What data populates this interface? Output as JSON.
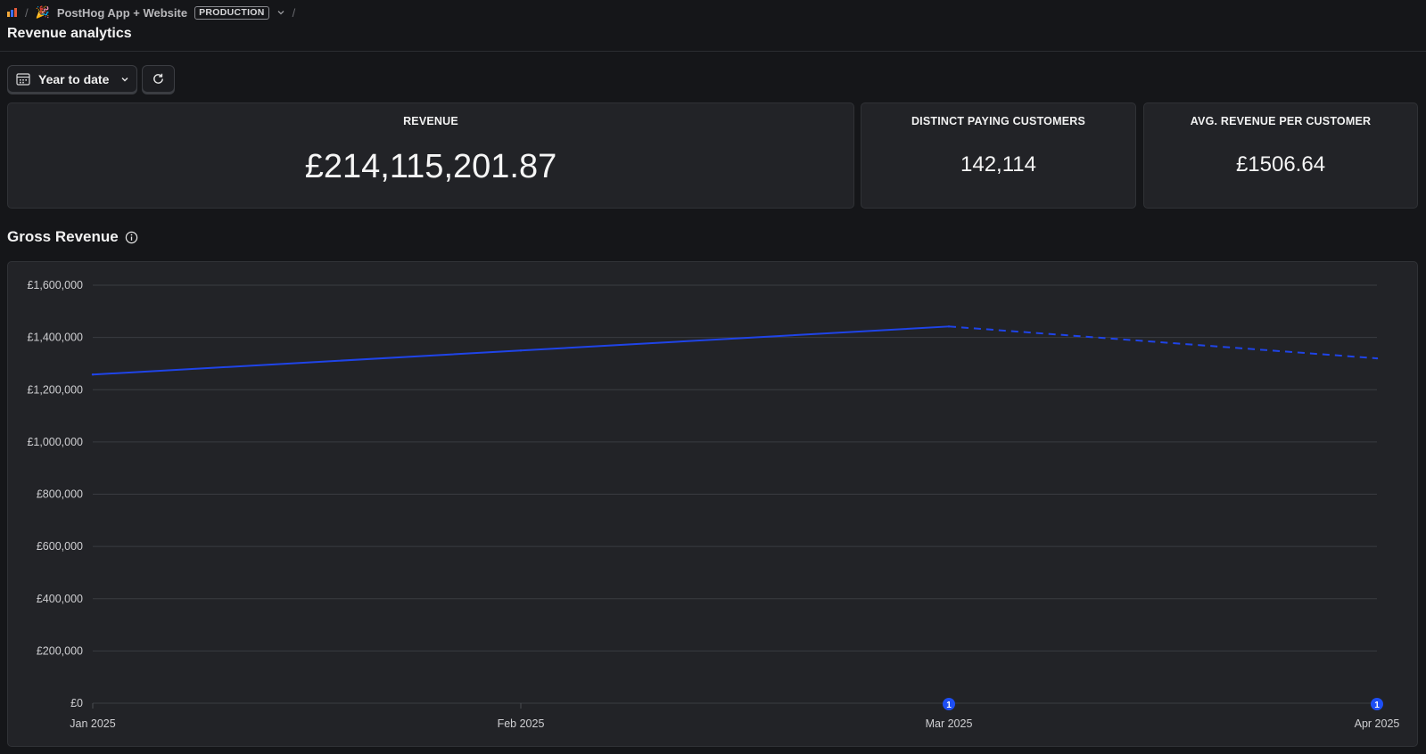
{
  "breadcrumb": {
    "project": "PostHog App + Website",
    "environment": "PRODUCTION",
    "separator": "/"
  },
  "page": {
    "title": "Revenue analytics"
  },
  "toolbar": {
    "date_range": "Year to date",
    "icons": {
      "calendar": "calendar-icon",
      "chevron": "chevron-down-icon",
      "refresh": "refresh-icon"
    }
  },
  "stats": {
    "revenue": {
      "label": "REVENUE",
      "value": "£214,115,201.87"
    },
    "customers": {
      "label": "DISTINCT PAYING CUSTOMERS",
      "value": "142,114"
    },
    "arpc": {
      "label": "AVG. REVENUE PER CUSTOMER",
      "value": "£1506.64"
    }
  },
  "section": {
    "title": "Gross Revenue"
  },
  "colors": {
    "background": "#151619",
    "card": "#222327",
    "series": "#1f44e8",
    "annotation": "#1d4ef5"
  },
  "chart_data": {
    "type": "line",
    "title": "",
    "xlabel": "",
    "ylabel": "",
    "categories": [
      "Jan 2025",
      "Feb 2025",
      "Mar 2025",
      "Apr 2025"
    ],
    "series": [
      {
        "values": [
          1258000,
          1350000,
          1442000,
          1320000
        ],
        "dashed_from_index": 2
      }
    ],
    "ylim": [
      0,
      1600000
    ],
    "yticks": [
      "£0",
      "£200,000",
      "£400,000",
      "£600,000",
      "£800,000",
      "£1,000,000",
      "£1,200,000",
      "£1,400,000",
      "£1,600,000"
    ],
    "annotations": [
      {
        "category": "Mar 2025",
        "count": "1"
      },
      {
        "category": "Apr 2025",
        "count": "1"
      }
    ],
    "grid": true
  }
}
